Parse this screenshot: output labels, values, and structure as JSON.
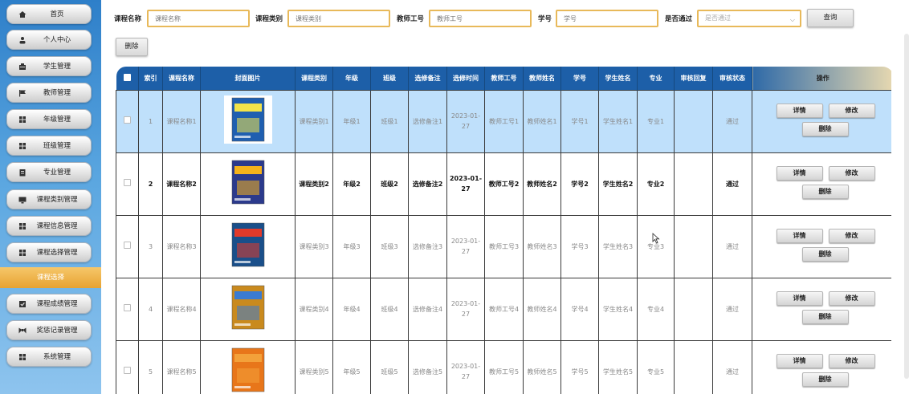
{
  "sidebar": {
    "items": [
      {
        "label": "首页",
        "icon": "home-icon"
      },
      {
        "label": "个人中心",
        "icon": "person-icon"
      },
      {
        "label": "学生管理",
        "icon": "student-icon"
      },
      {
        "label": "教师管理",
        "icon": "flag-icon"
      },
      {
        "label": "年级管理",
        "icon": "grid-icon"
      },
      {
        "label": "班级管理",
        "icon": "grid-icon"
      },
      {
        "label": "专业管理",
        "icon": "document-icon"
      },
      {
        "label": "课程类别管理",
        "icon": "monitor-icon"
      },
      {
        "label": "课程信息管理",
        "icon": "grid-icon"
      },
      {
        "label": "课程选择管理",
        "icon": "grid-icon"
      },
      {
        "label": "课程成绩管理",
        "icon": "checkbox-icon"
      },
      {
        "label": "奖惩记录管理",
        "icon": "bowtie-icon"
      },
      {
        "label": "系统管理",
        "icon": "grid-icon"
      }
    ],
    "active_label": "课程选择"
  },
  "search": {
    "course_name_label": "课程名称",
    "course_name_placeholder": "课程名称",
    "course_type_label": "课程类别",
    "course_type_placeholder": "课程类别",
    "teacher_no_label": "教师工号",
    "teacher_no_placeholder": "教师工号",
    "student_no_label": "学号",
    "student_no_placeholder": "学号",
    "approved_label": "是否通过",
    "approved_selected": "是否通过",
    "query_button": "查询",
    "delete_button": "删除"
  },
  "table": {
    "headers": [
      "索引",
      "课程名称",
      "封面图片",
      "课程类别",
      "年级",
      "班级",
      "选修备注",
      "选修时间",
      "教师工号",
      "教师姓名",
      "学号",
      "学生姓名",
      "专业",
      "审核回复",
      "审核状态",
      "操作"
    ],
    "rows": [
      {
        "index": "1",
        "course_name": "课程名称1",
        "course_type": "课程类别1",
        "grade": "年级1",
        "class_name": "班级1",
        "remark": "选修备注1",
        "time": "2023-01-27",
        "teacher_no": "教师工号1",
        "teacher_name": "教师姓名1",
        "student_no": "学号1",
        "student_name": "学生姓名1",
        "major": "专业1",
        "reply": "",
        "status": "通过",
        "cover_colors": [
          "#1f5fb0",
          "#f2e34a"
        ]
      },
      {
        "index": "2",
        "course_name": "课程名称2",
        "course_type": "课程类别2",
        "grade": "年级2",
        "class_name": "班级2",
        "remark": "选修备注2",
        "time": "2023-01-27",
        "teacher_no": "教师工号2",
        "teacher_name": "教师姓名2",
        "student_no": "学号2",
        "student_name": "学生姓名2",
        "major": "专业2",
        "reply": "",
        "status": "通过",
        "cover_colors": [
          "#2b3a8c",
          "#f5b21a"
        ]
      },
      {
        "index": "3",
        "course_name": "课程名称3",
        "course_type": "课程类别3",
        "grade": "年级3",
        "class_name": "班级3",
        "remark": "选修备注3",
        "time": "2023-01-27",
        "teacher_no": "教师工号3",
        "teacher_name": "教师姓名3",
        "student_no": "学号3",
        "student_name": "学生姓名3",
        "major": "专业3",
        "reply": "",
        "status": "通过",
        "cover_colors": [
          "#1a4f8a",
          "#e23a2a"
        ]
      },
      {
        "index": "4",
        "course_name": "课程名称4",
        "course_type": "课程类别4",
        "grade": "年级4",
        "class_name": "班级4",
        "remark": "选修备注4",
        "time": "2023-01-27",
        "teacher_no": "教师工号4",
        "teacher_name": "教师姓名4",
        "student_no": "学号4",
        "student_name": "学生姓名4",
        "major": "专业4",
        "reply": "",
        "status": "通过",
        "cover_colors": [
          "#c98a1e",
          "#3b7bd1"
        ]
      },
      {
        "index": "5",
        "course_name": "课程名称5",
        "course_type": "课程类别5",
        "grade": "年级5",
        "class_name": "班级5",
        "remark": "选修备注5",
        "time": "2023-01-27",
        "teacher_no": "教师工号5",
        "teacher_name": "教师姓名5",
        "student_no": "学号5",
        "student_name": "学生姓名5",
        "major": "专业5",
        "reply": "",
        "status": "通过",
        "cover_colors": [
          "#e8761a",
          "#f3a13a"
        ]
      }
    ],
    "actions": {
      "detail": "详情",
      "edit": "修改",
      "delete": "删除"
    }
  },
  "colors": {
    "header_bg": "#1d5fa8",
    "selected_row": "#bfe0fb",
    "input_border": "#e8b95a",
    "active_nav": "#e7a332"
  }
}
